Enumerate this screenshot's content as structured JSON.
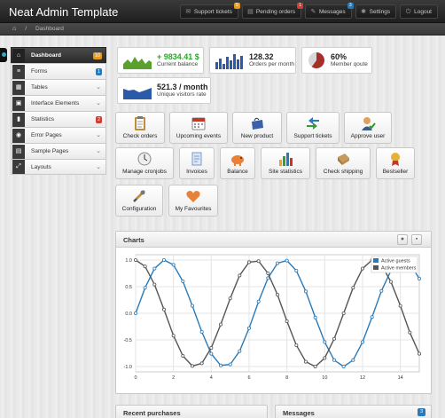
{
  "app": {
    "title": "Neat Admin Template"
  },
  "topnav": [
    {
      "label": "Support tickets",
      "badge": "5",
      "badge_color": "#e89a1e",
      "icon": "ticket-icon"
    },
    {
      "label": "Pending orders",
      "badge": "1",
      "badge_color": "#d23c32",
      "icon": "cart-icon"
    },
    {
      "label": "Messages",
      "badge": "3",
      "badge_color": "#2a7ab8",
      "icon": "mail-icon"
    },
    {
      "label": "Settings",
      "badge": "",
      "icon": "gear-icon"
    },
    {
      "label": "Logout",
      "badge": "",
      "icon": "power-icon"
    }
  ],
  "breadcrumb": {
    "current": "Dashboard",
    "separator": "/"
  },
  "sidebar": {
    "items": [
      {
        "label": "Dashboard",
        "icon": "home-icon",
        "active": true,
        "badge": "10",
        "badge_color": "#e89a1e"
      },
      {
        "label": "Forms",
        "icon": "form-icon",
        "badge": "1",
        "badge_color": "#2a7ab8"
      },
      {
        "label": "Tables",
        "icon": "table-icon",
        "chevron": true
      },
      {
        "label": "Interface Elements",
        "icon": "interface-icon",
        "chevron": true
      },
      {
        "label": "Statistics",
        "icon": "chart-icon",
        "badge": "2",
        "badge_color": "#d23c32"
      },
      {
        "label": "Error Pages",
        "icon": "error-icon",
        "chevron": true
      },
      {
        "label": "Sample Pages",
        "icon": "pages-icon",
        "chevron": true
      },
      {
        "label": "Layouts",
        "icon": "layout-icon",
        "chevron": true
      }
    ]
  },
  "stats": [
    {
      "value": "+ 9834.41 $",
      "label": "Current balance",
      "icon": "sparkline-area-icon"
    },
    {
      "value": "128.32",
      "label": "Orders per month",
      "icon": "sparkbar-icon"
    },
    {
      "value": "60%",
      "label": "Member qoute",
      "icon": "pie-icon",
      "percent": 60
    },
    {
      "value": "521.3 / month",
      "label": "Unique visitors rate",
      "icon": "sparkline-blue-icon"
    }
  ],
  "shortcuts": [
    {
      "label": "Check orders",
      "icon": "clipboard-icon"
    },
    {
      "label": "Upcoming events",
      "icon": "calendar-icon"
    },
    {
      "label": "New product",
      "icon": "shopping-bag-icon"
    },
    {
      "label": "Support tickets",
      "icon": "arrows-icon"
    },
    {
      "label": "Approve user",
      "icon": "user-check-icon"
    },
    {
      "label": "Manage cronjobs",
      "icon": "clock-icon"
    },
    {
      "label": "Invoices",
      "icon": "invoice-icon"
    },
    {
      "label": "Balance",
      "icon": "piggy-bank-icon"
    },
    {
      "label": "Site statistics",
      "icon": "bar-chart-icon"
    },
    {
      "label": "Check shipping",
      "icon": "package-icon"
    },
    {
      "label": "Bestseller",
      "icon": "award-icon"
    },
    {
      "label": "Configuration",
      "icon": "tools-icon"
    },
    {
      "label": "My Favourites",
      "icon": "heart-icon"
    }
  ],
  "charts_panel": {
    "title": "Charts"
  },
  "bottom": {
    "recent_purchases": "Recent purchases",
    "messages": "Messages",
    "messages_badge": "3"
  },
  "colors": {
    "accent_blue": "#2a7ab8",
    "series_grey": "#555555"
  },
  "chart_data": {
    "type": "line",
    "x_ticks": [
      0,
      2,
      4,
      6,
      8,
      10,
      12,
      14
    ],
    "y_ticks": [
      -1.0,
      -0.5,
      0.0,
      0.5,
      1.0
    ],
    "y_tick_labels": [
      "-1.0",
      "-0.5",
      "0.0",
      "0.5",
      "1.0"
    ],
    "xlim": [
      0,
      15
    ],
    "ylim": [
      -1.1,
      1.1
    ],
    "grid": true,
    "legend": "top-right",
    "x": [
      0,
      0.5,
      1,
      1.5,
      2,
      2.5,
      3,
      3.5,
      4,
      4.5,
      5,
      5.5,
      6,
      6.5,
      7,
      7.5,
      8,
      8.5,
      9,
      9.5,
      10,
      10.5,
      11,
      11.5,
      12,
      12.5,
      13,
      13.5,
      14,
      14.5,
      15
    ],
    "series": [
      {
        "name": "Active guests",
        "color": "#2a7ab8",
        "values": [
          0.0,
          0.48,
          0.84,
          1.0,
          0.91,
          0.6,
          0.14,
          -0.35,
          -0.76,
          -0.98,
          -0.96,
          -0.71,
          -0.28,
          0.22,
          0.66,
          0.94,
          0.99,
          0.8,
          0.41,
          -0.08,
          -0.54,
          -0.88,
          -1.0,
          -0.88,
          -0.54,
          -0.07,
          0.42,
          0.8,
          0.99,
          0.94,
          0.65
        ]
      },
      {
        "name": "Active members",
        "color": "#555555",
        "values": [
          1.0,
          0.88,
          0.54,
          0.07,
          -0.42,
          -0.8,
          -0.99,
          -0.94,
          -0.65,
          -0.21,
          0.28,
          0.71,
          0.96,
          0.98,
          0.75,
          0.35,
          -0.15,
          -0.6,
          -0.91,
          -1.0,
          -0.84,
          -0.48,
          0.0,
          0.48,
          0.84,
          1.0,
          0.91,
          0.59,
          0.14,
          -0.36,
          -0.76
        ]
      }
    ]
  }
}
